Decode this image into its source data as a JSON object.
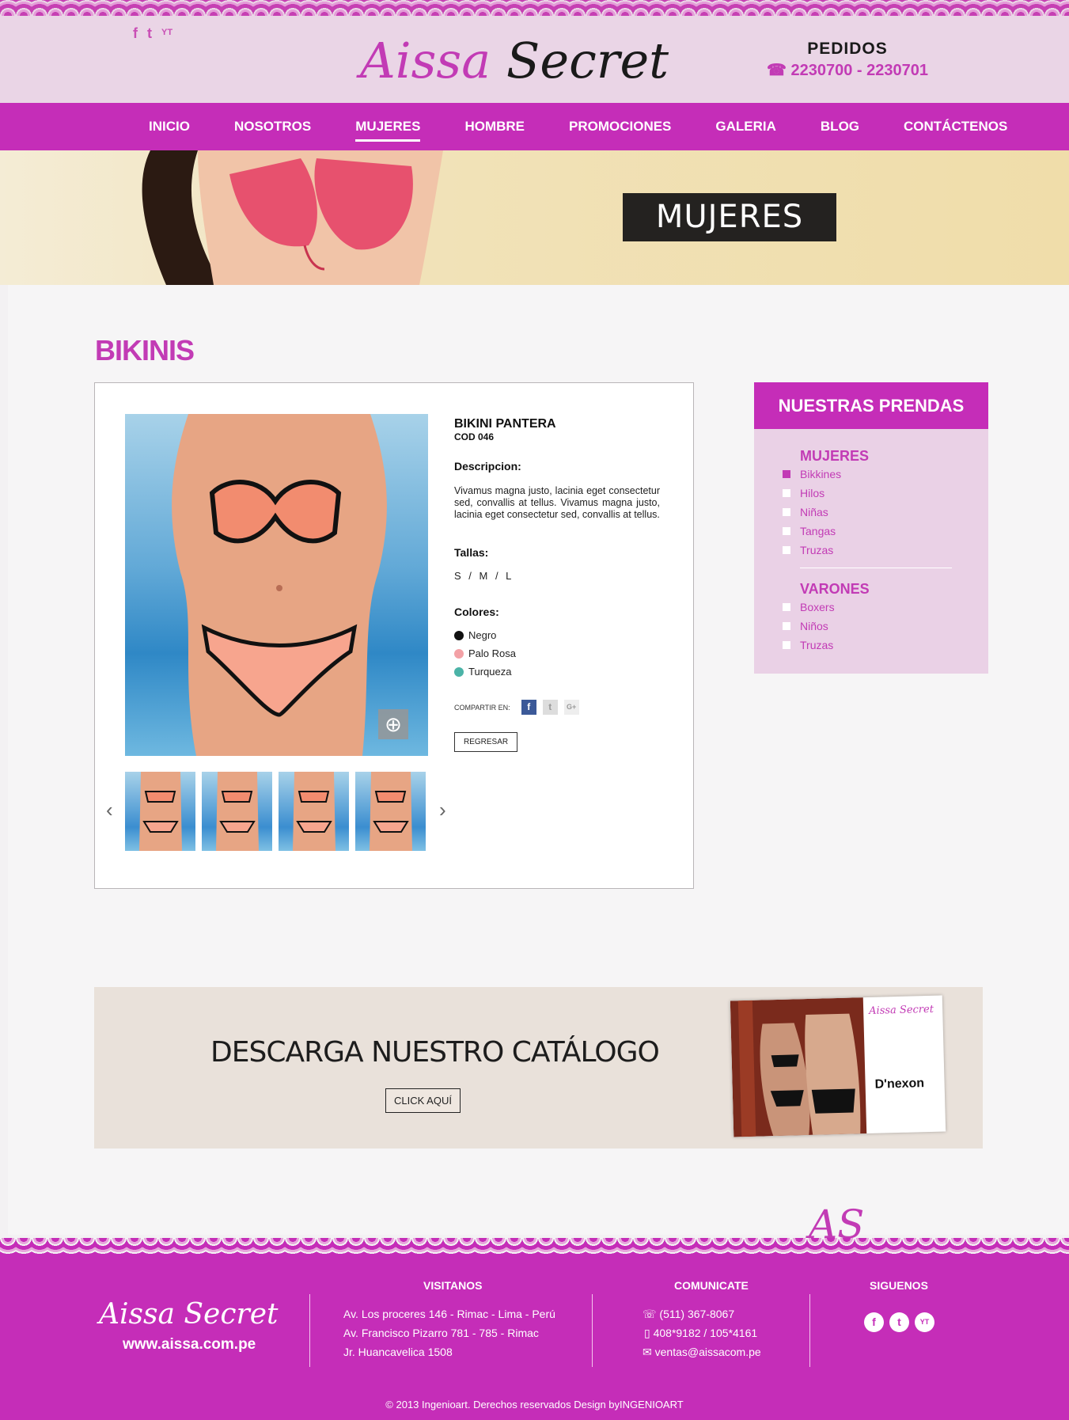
{
  "header": {
    "social": [
      "f",
      "t",
      "YT"
    ],
    "logo_a": "Aissa",
    "logo_s": "Secret",
    "pedidos_title": "PEDIDOS",
    "pedidos_phones": "☎ 2230700 -  2230701"
  },
  "nav": [
    "INICIO",
    "NOSOTROS",
    "MUJERES",
    "HOMBRE",
    "PROMOCIONES",
    "GALERIA",
    "BLOG",
    "CONTÁCTENOS"
  ],
  "hero": {
    "title": "MUJERES"
  },
  "section_title": "BIKINIS",
  "product": {
    "name": "BIKINI PANTERA",
    "code": "COD 046",
    "desc_label": "Descripcion:",
    "description": "Vivamus magna justo, lacinia eget consectetur sed, convallis at tellus. Vivamus magna justo, lacinia eget consectetur sed, convallis at tellus.",
    "sizes_label": "Tallas:",
    "sizes": "S / M / L",
    "colors_label": "Colores:",
    "colors": [
      {
        "name": "Negro",
        "hex": "#111111"
      },
      {
        "name": "Palo Rosa",
        "hex": "#f3a1a6"
      },
      {
        "name": "Turqueza",
        "hex": "#4bb3a7"
      }
    ],
    "share_label": "COMPARTIR EN:",
    "share_buttons": [
      "f",
      "t",
      "G+"
    ],
    "back_label": "REGRESAR"
  },
  "sidebar": {
    "title": "NUESTRAS PRENDAS",
    "women_title": "MUJERES",
    "women": [
      "Bikkines",
      "Hilos",
      "Niñas",
      "Tangas",
      "Truzas"
    ],
    "men_title": "VARONES",
    "men": [
      "Boxers",
      "Niños",
      "Truzas"
    ]
  },
  "catalog": {
    "title": "DESCARGA NUESTRO CATÁLOGO",
    "button": "CLICK AQUÍ",
    "brand1": "Aissa Secret",
    "brand2": "D'nexon"
  },
  "footer": {
    "logo": "Aissa Secret",
    "url": "www.aissa.com.pe",
    "visitanos_title": "VISITANOS",
    "addresses": [
      "Av. Los proceres 146 - Rimac - Lima - Perú",
      "Av. Francisco Pizarro 781 - 785 - Rimac",
      "Jr. Huancavelica 1508"
    ],
    "comunicate_title": "COMUNICATE",
    "phone": "(511) 367-8067",
    "mobile": "408*9182 / 105*4161",
    "email": "ventas@aissacom.pe",
    "siguenos_title": "SIGUENOS",
    "copyright": "© 2013 Ingenioart. Derechos reservados Design byINGENIOART",
    "mark": "AS"
  },
  "colors": {
    "accent": "#c52db8",
    "brand_text": "#c23bb5",
    "header_bg": "#ead5e6"
  }
}
